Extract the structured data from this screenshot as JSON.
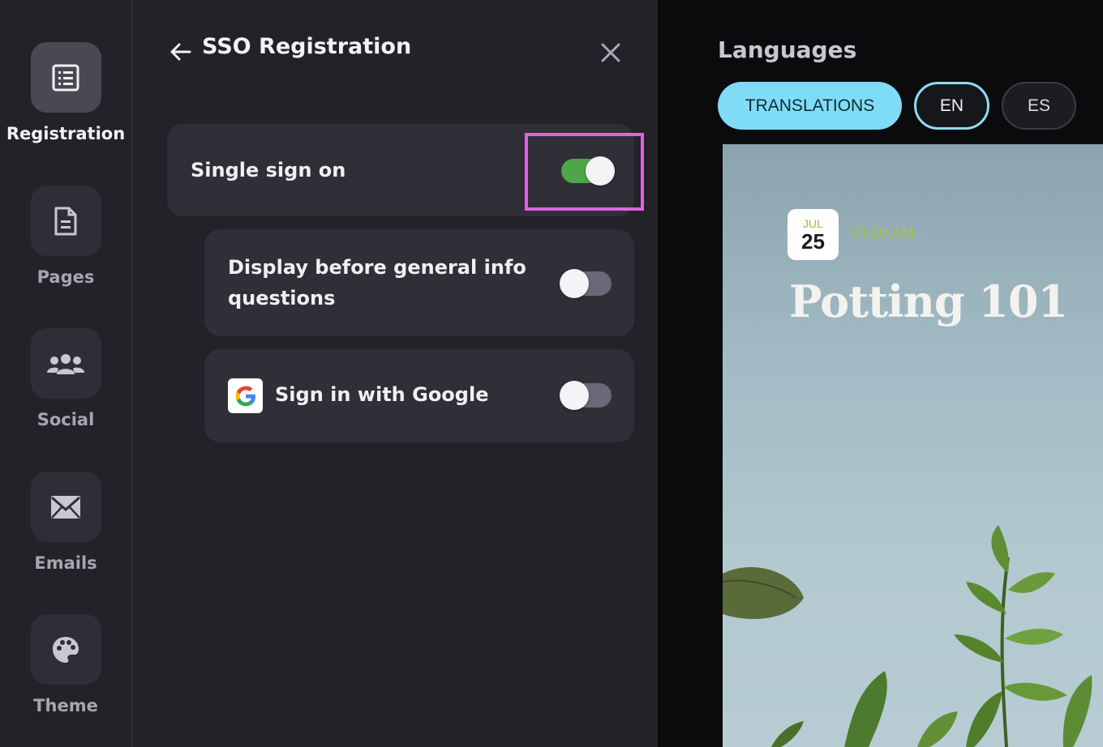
{
  "sidebar": {
    "items": [
      {
        "label": "Registration",
        "icon": "list-document-icon",
        "active": true
      },
      {
        "label": "Pages",
        "icon": "page-icon"
      },
      {
        "label": "Social",
        "icon": "people-icon"
      },
      {
        "label": "Emails",
        "icon": "envelope-icon"
      },
      {
        "label": "Theme",
        "icon": "palette-icon"
      }
    ]
  },
  "panel": {
    "title": "SSO Registration",
    "settings": [
      {
        "label": "Single sign on",
        "enabled": true
      },
      {
        "label": "Display before general info questions",
        "enabled": false
      },
      {
        "label": "Sign in with Google",
        "enabled": false,
        "icon": "google-icon"
      }
    ]
  },
  "languages": {
    "title": "Languages",
    "buttons": [
      "TRANSLATIONS",
      "EN",
      "ES"
    ],
    "selected": "EN"
  },
  "preview": {
    "month": "JUL",
    "day": "25",
    "time": "10:00 AM",
    "event_title": "Potting 101"
  },
  "colors": {
    "accent": "#7fdcf6",
    "toggle_on": "#4fa64a",
    "highlight": "#e45ee8",
    "date_accent": "#9bbf3a"
  }
}
